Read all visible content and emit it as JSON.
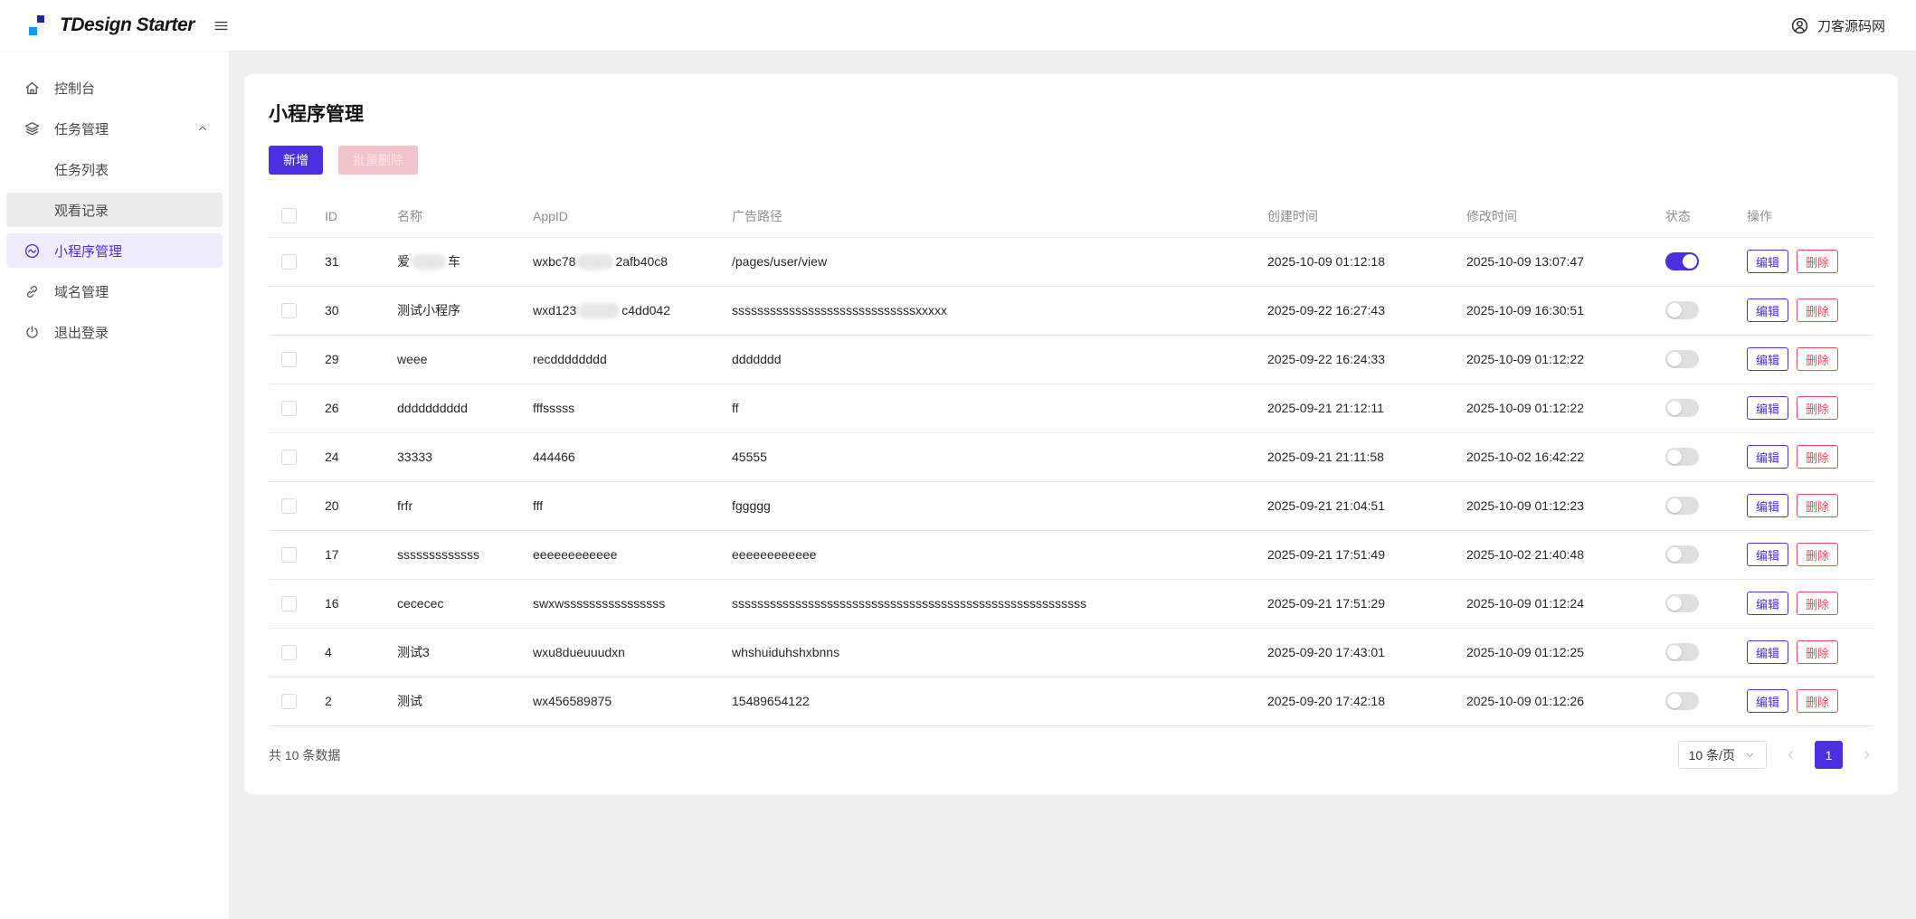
{
  "header": {
    "brand": "TDesign Starter",
    "logo_icon": "two-squares",
    "menu_icon": "hamburger",
    "user_icon": "user",
    "user_name": "刀客源码网"
  },
  "sidebar": {
    "items": [
      {
        "key": "dashboard",
        "label": "控制台",
        "icon": "home"
      },
      {
        "key": "tasks",
        "label": "任务管理",
        "icon": "layers",
        "expanded": true
      },
      {
        "key": "task-list",
        "label": "任务列表",
        "sub": true
      },
      {
        "key": "watch-record",
        "label": "观看记录",
        "sub": true,
        "highlight": true
      },
      {
        "key": "miniprogram",
        "label": "小程序管理",
        "icon": "miniprogram",
        "active": true
      },
      {
        "key": "domain",
        "label": "域名管理",
        "icon": "link"
      },
      {
        "key": "logout",
        "label": "退出登录",
        "icon": "power"
      }
    ]
  },
  "main": {
    "title": "小程序管理",
    "buttons": {
      "add": "新增",
      "batch_delete": "批量删除"
    },
    "table": {
      "columns": [
        "ID",
        "名称",
        "AppID",
        "广告路径",
        "创建时间",
        "修改时间",
        "状态",
        "操作"
      ],
      "edit_label": "编辑",
      "delete_label": "删除",
      "rows": [
        {
          "id": "31",
          "name": {
            "pre": "爱",
            "post": "车",
            "blur_w": 38
          },
          "appid": {
            "pre": "wxbc78",
            "post": "2afb40c8",
            "blur_w": 40
          },
          "path": "/pages/user/view",
          "created": "2025-10-09 01:12:18",
          "modified": "2025-10-09 13:07:47",
          "status": "on"
        },
        {
          "id": "30",
          "name": "测试小程序",
          "appid": {
            "pre": "wxd123",
            "post": "c4dd042",
            "blur_w": 46
          },
          "path": "sssssssssssssssssssssssssssssxxxxx",
          "created": "2025-09-22 16:27:43",
          "modified": "2025-10-09 16:30:51",
          "status": "off"
        },
        {
          "id": "29",
          "name": "weee",
          "appid": "recdddddddd",
          "path": "ddddddd",
          "created": "2025-09-22 16:24:33",
          "modified": "2025-10-09 01:12:22",
          "status": "off"
        },
        {
          "id": "26",
          "name": "dddddddddd",
          "appid": "fffsssss",
          "path": "ff",
          "created": "2025-09-21 21:12:11",
          "modified": "2025-10-09 01:12:22",
          "status": "off"
        },
        {
          "id": "24",
          "name": "33333",
          "appid": "444466",
          "path": "45555",
          "created": "2025-09-21 21:11:58",
          "modified": "2025-10-02 16:42:22",
          "status": "off"
        },
        {
          "id": "20",
          "name": "frfr",
          "appid": "fff",
          "path": "fggggg",
          "created": "2025-09-21 21:04:51",
          "modified": "2025-10-09 01:12:23",
          "status": "off"
        },
        {
          "id": "17",
          "name": "sssssssssssss",
          "appid": "eeeeeeeeeeee",
          "path": "eeeeeeeeeeee",
          "created": "2025-09-21 17:51:49",
          "modified": "2025-10-02 21:40:48",
          "status": "off"
        },
        {
          "id": "16",
          "name": "cececec",
          "appid": "swxwssssssssssssssss",
          "path": "ssssssssssssssssssssssssssssssssssssssssssssssssssssssss",
          "created": "2025-09-21 17:51:29",
          "modified": "2025-10-09 01:12:24",
          "status": "off"
        },
        {
          "id": "4",
          "name": "测试3",
          "appid": "wxu8dueuuudxn",
          "path": "whshuiduhshxbnns",
          "created": "2025-09-20 17:43:01",
          "modified": "2025-10-09 01:12:25",
          "status": "off"
        },
        {
          "id": "2",
          "name": "测试",
          "appid": "wx456589875",
          "path": "15489654122",
          "created": "2025-09-20 17:42:18",
          "modified": "2025-10-09 01:12:26",
          "status": "off"
        }
      ]
    },
    "footer": {
      "total_text": "共 10 条数据",
      "page_size_label": "10 条/页",
      "page_size_chevron": "chevron-down",
      "prev_icon": "chevron-left",
      "next_icon": "chevron-right",
      "current_page": "1"
    }
  },
  "colors": {
    "brand": "#4c2fe0",
    "brand_light_bg": "#f1ebfe",
    "danger": "#e34d59",
    "danger_disabled_bg": "#f3c3cc",
    "page_bg": "#eef0f2",
    "logo_dark_blue": "#23249f",
    "logo_bright_blue": "#149aff"
  }
}
